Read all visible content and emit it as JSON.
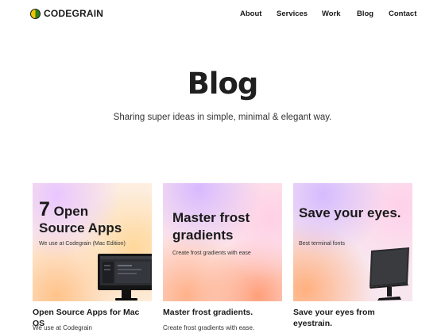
{
  "header": {
    "logo_text": "CODEGRAIN",
    "nav": [
      "About",
      "Services",
      "Work",
      "Blog",
      "Contact"
    ]
  },
  "hero": {
    "title": "Blog",
    "subtitle": "Sharing super ideas in simple, minimal & elegant way."
  },
  "cards": [
    {
      "thumb_title_big": "7",
      "thumb_title_rest": " Open",
      "thumb_title_line2": "Source Apps",
      "thumb_subtitle": "We use at Codegrain (Mac Edition)",
      "title": "Open Source Apps for Mac OS",
      "excerpt": "We use at Codegrain",
      "image_icon": "imac-icon"
    },
    {
      "thumb_title": "Master frost gradients",
      "thumb_subtitle": "Create frost gradients with ease",
      "title": "Master frost gradients.",
      "excerpt": "Create frost gradients with ease."
    },
    {
      "thumb_title": "Save your eyes.",
      "thumb_subtitle": "Best terminal fonts",
      "title": "Save your eyes from eyestrain.",
      "image_icon": "monitor-icon"
    }
  ],
  "colors": {
    "text": "#1a1a1a",
    "background": "#ffffff",
    "logo_green": "#2f7d1f",
    "logo_yellow": "#f2c400"
  }
}
